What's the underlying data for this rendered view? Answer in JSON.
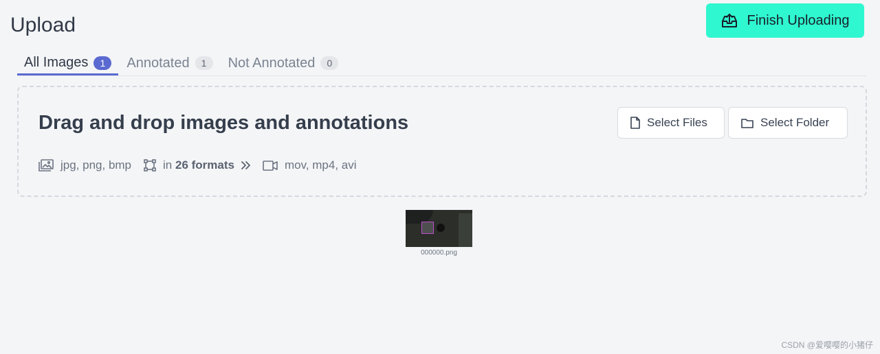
{
  "page": {
    "title": "Upload"
  },
  "header": {
    "finish_button_label": "Finish Uploading",
    "finish_icon": "upload-tray-icon"
  },
  "tabs": [
    {
      "label": "All Images",
      "count": "1",
      "active": true
    },
    {
      "label": "Annotated",
      "count": "1",
      "active": false
    },
    {
      "label": "Not Annotated",
      "count": "0",
      "active": false
    }
  ],
  "dropzone": {
    "title": "Drag and drop images and annotations",
    "select_files_label": "Select Files",
    "select_folder_label": "Select Folder",
    "formats": {
      "images": "jpg, png, bmp",
      "annotations_prefix": "in",
      "annotations_count": "26 formats",
      "videos": "mov, mp4, avi"
    }
  },
  "images": [
    {
      "filename": "000000.png"
    }
  ],
  "watermark": "CSDN @爱嘤嘤的小猪仔",
  "colors": {
    "accent": "#5a6ad1",
    "finish_button": "#2ff7cf",
    "background": "#f4f5f7"
  }
}
